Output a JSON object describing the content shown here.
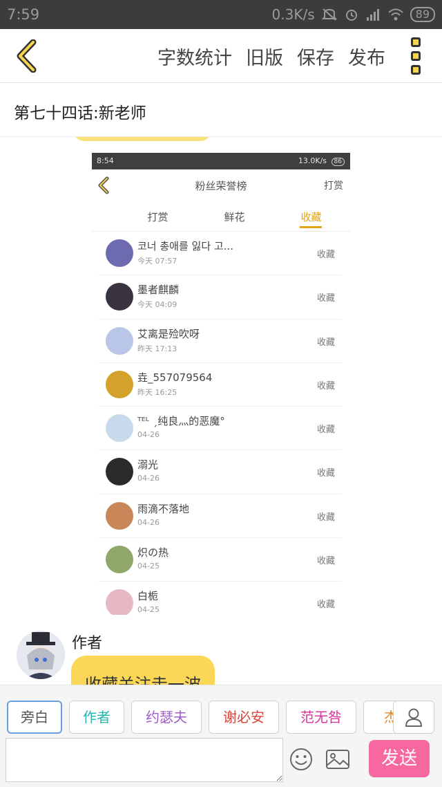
{
  "status_bar": {
    "time": "7:59",
    "speed": "0.3K/s",
    "battery": "89"
  },
  "toolbar": {
    "word_count_label": "字数统计",
    "old_version_label": "旧版",
    "save_label": "保存",
    "publish_label": "发布"
  },
  "chapter": {
    "title": "第七十四话:新老师"
  },
  "embedded_screenshot": {
    "status_time": "8:54",
    "status_speed": "13.0K/s",
    "status_battery": "86",
    "title": "粉丝荣誉榜",
    "header_action": "打赏",
    "tabs": [
      {
        "label": "打赏"
      },
      {
        "label": "鲜花"
      },
      {
        "label": "收藏"
      }
    ],
    "active_tab": "收藏",
    "rows": [
      {
        "name": "코너 총애를 잃다 고...",
        "time": "今天 07:57",
        "action": "收藏",
        "avatar_color": "#6d6ab0"
      },
      {
        "name": "墨者麒麟",
        "time": "今天 04:09",
        "action": "收藏",
        "avatar_color": "#3a3440"
      },
      {
        "name": "艾离是殓吹呀",
        "time": "昨天 17:13",
        "action": "收藏",
        "avatar_color": "#b9c6e8"
      },
      {
        "name": "垚_557079564",
        "time": "昨天 16:25",
        "action": "收藏",
        "avatar_color": "#d4a12a"
      },
      {
        "name": "ᵀᴱᴸ ˏ纯良灬的恶魔°",
        "time": "04-26",
        "action": "收藏",
        "avatar_color": "#c7d9ea"
      },
      {
        "name": "溺光",
        "time": "04-26",
        "action": "收藏",
        "avatar_color": "#2b2b2b"
      },
      {
        "name": "雨滴不落地",
        "time": "04-26",
        "action": "收藏",
        "avatar_color": "#c9875a"
      },
      {
        "name": "炽の热",
        "time": "04-25",
        "action": "收藏",
        "avatar_color": "#8fa86a"
      },
      {
        "name": "白栀",
        "time": "04-25",
        "action": "收藏",
        "avatar_color": "#e6b9c2"
      }
    ]
  },
  "author_message": {
    "name": "作者",
    "text": "收藏关注走一波"
  },
  "roles": [
    {
      "label": "旁白",
      "color": "#555555",
      "selected": true
    },
    {
      "label": "作者",
      "color": "#25b6b0",
      "selected": false
    },
    {
      "label": "约瑟夫",
      "color": "#a05cc8",
      "selected": false
    },
    {
      "label": "谢必安",
      "color": "#d9433b",
      "selected": false
    },
    {
      "label": "范无咎",
      "color": "#d9339a",
      "selected": false
    },
    {
      "label": "杰",
      "color": "#e08a2c",
      "selected": false
    }
  ],
  "input": {
    "value": "",
    "send_label": "发送"
  },
  "colors": {
    "accent_yellow": "#fbd758",
    "send_pink": "#f767a0"
  }
}
